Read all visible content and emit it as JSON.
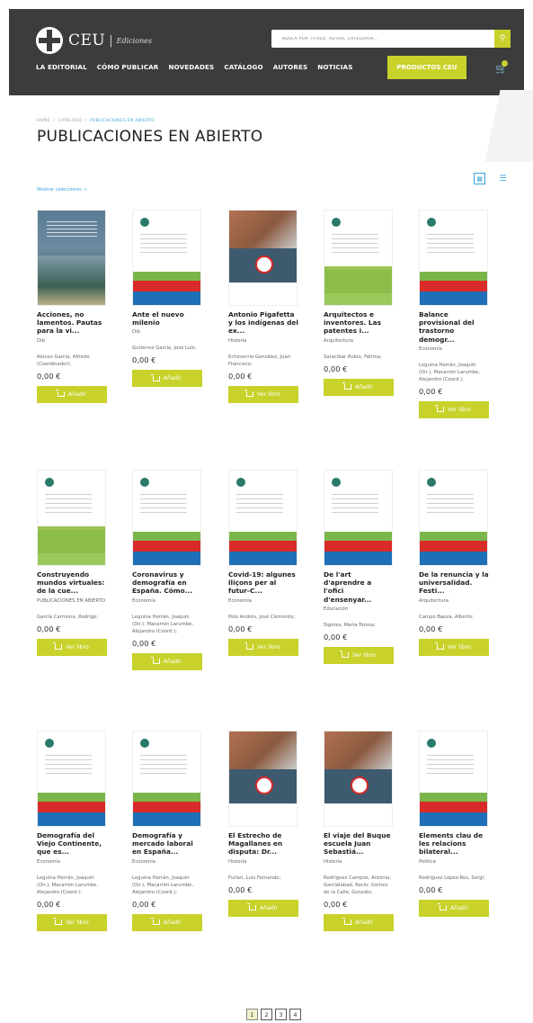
{
  "header": {
    "logo_text": "CEU",
    "logo_separator": "|",
    "logo_sub": "Ediciones",
    "search_placeholder": "BUSCA POR TÍTULO, AUTOR, CATEGORÍA...",
    "nav": [
      "LA EDITORIAL",
      "CÓMO PUBLICAR",
      "NOVEDADES",
      "CATÁLOGO",
      "AUTORES",
      "NOTICIAS"
    ],
    "products_button": "PRODUCTOS CEU"
  },
  "breadcrumb": {
    "home": "HOME",
    "sep": "/",
    "catalog": "CATÁLOGO",
    "current": "PUBLICACIONES EN ABIERTO"
  },
  "page_title": "PUBLICACIONES EN ABIERTO",
  "show_collections": "Mostrar colecciones →",
  "products": [
    {
      "title": "Acciones, no lamentos. Pautas para la vi...",
      "category": "Dib",
      "authors": "Alonso García, Alfredo (Coordinador);",
      "price": "0,00 €",
      "button": "Añadir"
    },
    {
      "title": "Ante el nuevo milenio",
      "category": "Dib",
      "authors": "Gutiérrez García, José Luis;",
      "price": "0,00 €",
      "button": "Añadir"
    },
    {
      "title": "Antonio Pigafetta y los indígenas del ex...",
      "category": "Historia",
      "authors": "Echeverría González, Juan Francisco;",
      "price": "0,00 €",
      "button": "Ver libro"
    },
    {
      "title": "Arquitectos e inventores. Las patentes i...",
      "category": "Arquitectura",
      "authors": "Saracíbar Rubio, Fátima;",
      "price": "0,00 €",
      "button": "Añadir"
    },
    {
      "title": "Balance provisional del trastorno demogr...",
      "category": "Economía",
      "authors": "Leguina Herrán, Joaquín (Dir.); Macarrón Larumbe, Alejandro (Coord.);",
      "price": "0,00 €",
      "button": "Ver libro"
    },
    {
      "title": "Construyendo mundos virtuales: de la cue...",
      "category": "PUBLICACIONES EN ABIERTO",
      "authors": "García Carmona, Rodrigo;",
      "price": "0,00 €",
      "button": "Ver libro"
    },
    {
      "title": "Coronavirus y demografía en España. Cómo...",
      "category": "Economía",
      "authors": "Leguina Herrán, Joaquín (Dir.); Macarrón Larumbe, Alejandro (Coord.);",
      "price": "0,00 €",
      "button": "Añadir"
    },
    {
      "title": "Covid-19: algunes lliçons per al futur-C...",
      "category": "Economía",
      "authors": "Polo Andrés, José Clemente;",
      "price": "0,00 €",
      "button": "Ver libro"
    },
    {
      "title": "De l'art d'aprendre a l'ofici d'ensenyar...",
      "category": "Educación",
      "authors": "Sigmes, Maria Teresa;",
      "price": "0,00 €",
      "button": "Ver libro"
    },
    {
      "title": "De la renuncia y la universalidad. Festi...",
      "category": "Arquitectura",
      "authors": "Campo Baeza, Alberto;",
      "price": "0,00 €",
      "button": "Ver libro"
    },
    {
      "title": "Demografía del Viejo Continente, que es...",
      "category": "Economía",
      "authors": "Leguina Herrán, Joaquín (Dir.); Macarrón Larumbe, Alejandro (Coord.);",
      "price": "0,00 €",
      "button": "Ver libro"
    },
    {
      "title": "Demografía y mercado laboral en España...",
      "category": "Economía",
      "authors": "Leguina Herrán, Joaquín (Dir.); Macarrón Larumbe, Alejandro (Coord.);",
      "price": "0,00 €",
      "button": "Añadir"
    },
    {
      "title": "El Estrecho de Magallanes en disputa: Dr...",
      "category": "Historia",
      "authors": "Furlan, Luis Fernando;",
      "price": "0,00 €",
      "button": "Añadir"
    },
    {
      "title": "El viaje del Buque escuela Juan Sebastiá...",
      "category": "Historia",
      "authors": "Rodríguez Campos, Antonia; Garcíalabad, Rocío; Gómez de la Calle, Gonzalo;",
      "price": "0,00 €",
      "button": "Añadir"
    },
    {
      "title": "Elements clau de les relacions bilateral...",
      "category": "Política",
      "authors": "Rodríguez López-Ros, Sergi;",
      "price": "0,00 €",
      "button": "Añadir"
    }
  ],
  "pagination": [
    "1",
    "2",
    "3",
    "4"
  ],
  "colors": {
    "header_bg": "#3c3c3c",
    "accent": "#c8d22a",
    "link": "#3aa3d8"
  }
}
